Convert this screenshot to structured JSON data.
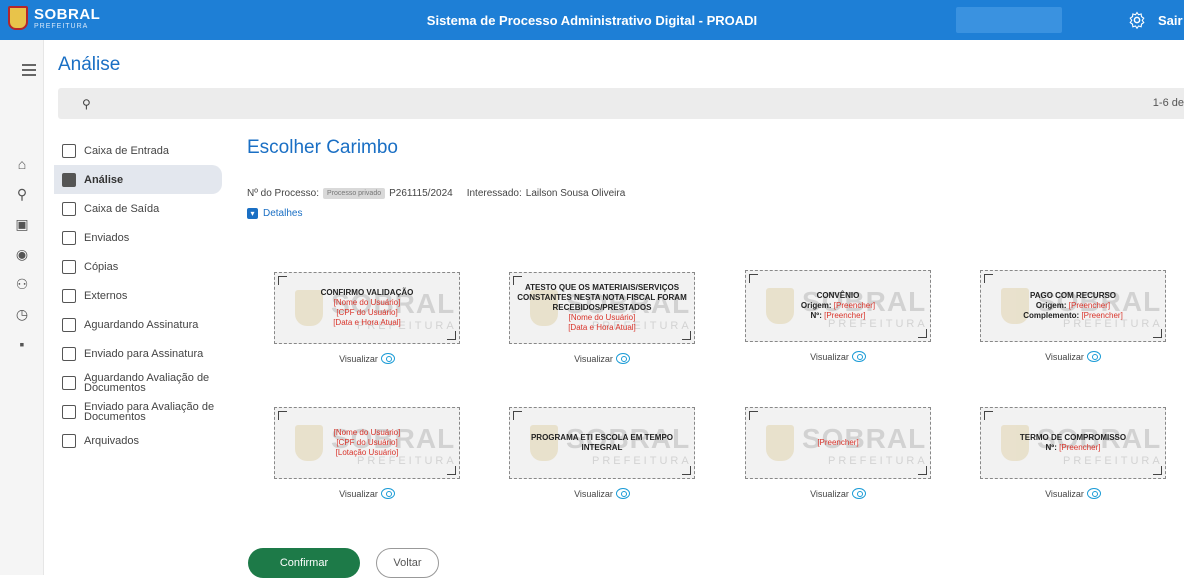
{
  "header": {
    "logo_main": "SOBRAL",
    "logo_sub": "PREFEITURA",
    "system_title": "Sistema de Processo Administrativo Digital - PROADI",
    "logout_label": "Sair",
    "settings_icon": "gear-icon"
  },
  "page": {
    "title": "Análise",
    "pagination": "1-6 de"
  },
  "menu": [
    {
      "label": "Caixa de Entrada",
      "icon": "inbox-icon"
    },
    {
      "label": "Análise",
      "icon": "analysis-icon",
      "active": true
    },
    {
      "label": "Caixa de Saída",
      "icon": "outbox-icon"
    },
    {
      "label": "Enviados",
      "icon": "sent-icon"
    },
    {
      "label": "Cópias",
      "icon": "copies-icon"
    },
    {
      "label": "Externos",
      "icon": "external-icon"
    },
    {
      "label": "Aguardando Assinatura",
      "icon": "signature-pending-icon"
    },
    {
      "label": "Enviado para Assinatura",
      "icon": "signature-sent-icon"
    },
    {
      "label": "Aguardando Avaliação de Documentos",
      "icon": "evaluation-pending-icon"
    },
    {
      "label": "Enviado para Avaliação de Documentos",
      "icon": "evaluation-sent-icon"
    },
    {
      "label": "Arquivados",
      "icon": "archive-icon"
    }
  ],
  "content": {
    "title": "Escolher Carimbo",
    "process_label": "Nº do Processo:",
    "process_badge": "Processo privado",
    "process_number": "P261115/2024",
    "interested_label": "Interessado:",
    "interested_name": "Lailson Sousa Oliveira",
    "details_label": "Detalhes"
  },
  "watermark": {
    "title": "SOBRAL",
    "subtitle": "PREFEITURA"
  },
  "view_label": "Visualizar",
  "stamps": {
    "s1": {
      "title": "CONFIRMO VALIDAÇÃO",
      "l1": "[Nome do Usuário]",
      "l2": "[CPF do Usuário]",
      "l3": "[Data e Hora Atual]"
    },
    "s2": {
      "t1": "ATESTO QUE OS MATERIAIS/SERVIÇOS",
      "t2": "CONSTANTES NESTA NOTA FISCAL FORAM",
      "t3": "RECEBIDOS/PRESTADOS",
      "l1": "[Nome do Usuário]",
      "l2": "[Data e Hora Atual]"
    },
    "s3": {
      "title": "CONVÊNIO",
      "k1": "Origem:",
      "v1": "[Preencher]",
      "k2": "Nº:",
      "v2": "[Preencher]"
    },
    "s4": {
      "title": "PAGO COM RECURSO",
      "k1": "Origem:",
      "v1": "[Preencher]",
      "k2": "Complemento:",
      "v2": "[Preencher]"
    },
    "s5": {
      "l1": "[Nome do Usuário]",
      "l2": "[CPF do Usuário]",
      "l3": "[Lotação Usuário]"
    },
    "s6": {
      "t1": "PROGRAMA ETI ESCOLA EM TEMPO",
      "t2": "INTEGRAL"
    },
    "s7": {
      "l1": "[Preencher]"
    },
    "s8": {
      "title": "TERMO DE COMPROMISSO",
      "k1": "Nº:",
      "v1": "[Preencher]"
    }
  },
  "actions": {
    "confirm_label": "Confirmar",
    "back_label": "Voltar"
  }
}
